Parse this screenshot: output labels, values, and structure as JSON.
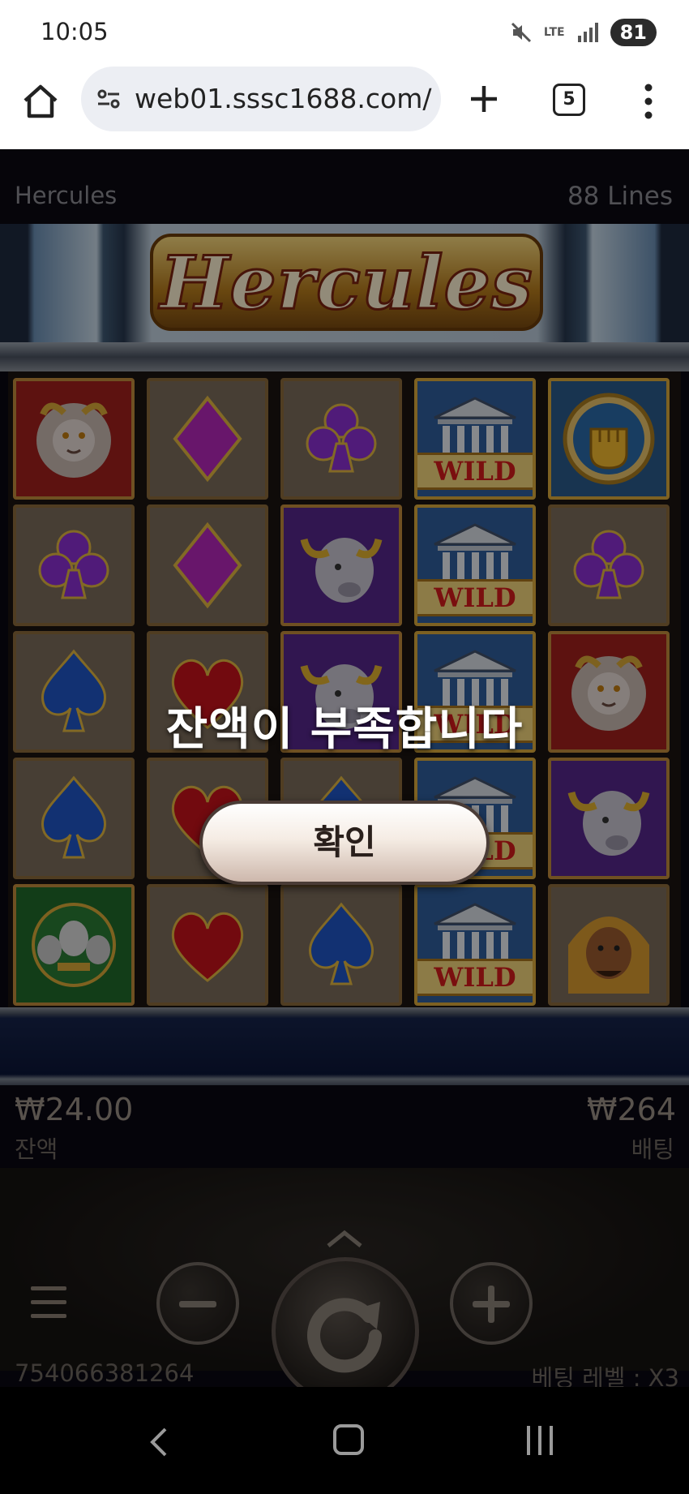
{
  "status_bar": {
    "time": "10:05",
    "network": "LTE",
    "battery": "81"
  },
  "browser": {
    "url": "web01.sssc1688.com/",
    "tab_count": "5"
  },
  "game": {
    "name": "Hercules",
    "lines": "88 Lines",
    "logo": "Hercules",
    "wild_label": "WILD",
    "balance_value": "₩24.00",
    "balance_label": "잔액",
    "bet_value": "₩264",
    "bet_label": "배팅",
    "game_id": "754066381264",
    "bet_level": "베팅 레벨 : X3"
  },
  "reels": [
    [
      "lion",
      "club",
      "spade",
      "spade",
      "cerberus"
    ],
    [
      "diamond",
      "diamond",
      "heart",
      "heart",
      "heart"
    ],
    [
      "club",
      "bull",
      "bull",
      "spade",
      "spade"
    ],
    [
      "wild",
      "wild",
      "wild",
      "wild",
      "wild"
    ],
    [
      "fist",
      "club",
      "lion",
      "bull",
      "hercules"
    ]
  ],
  "popup": {
    "message": "잔액이 부족합니다",
    "confirm_label": "확인"
  },
  "colors": {
    "dim_overlay": "#000000",
    "reel_frame": "#8a6a3c",
    "wild_text": "#d21a1a"
  }
}
